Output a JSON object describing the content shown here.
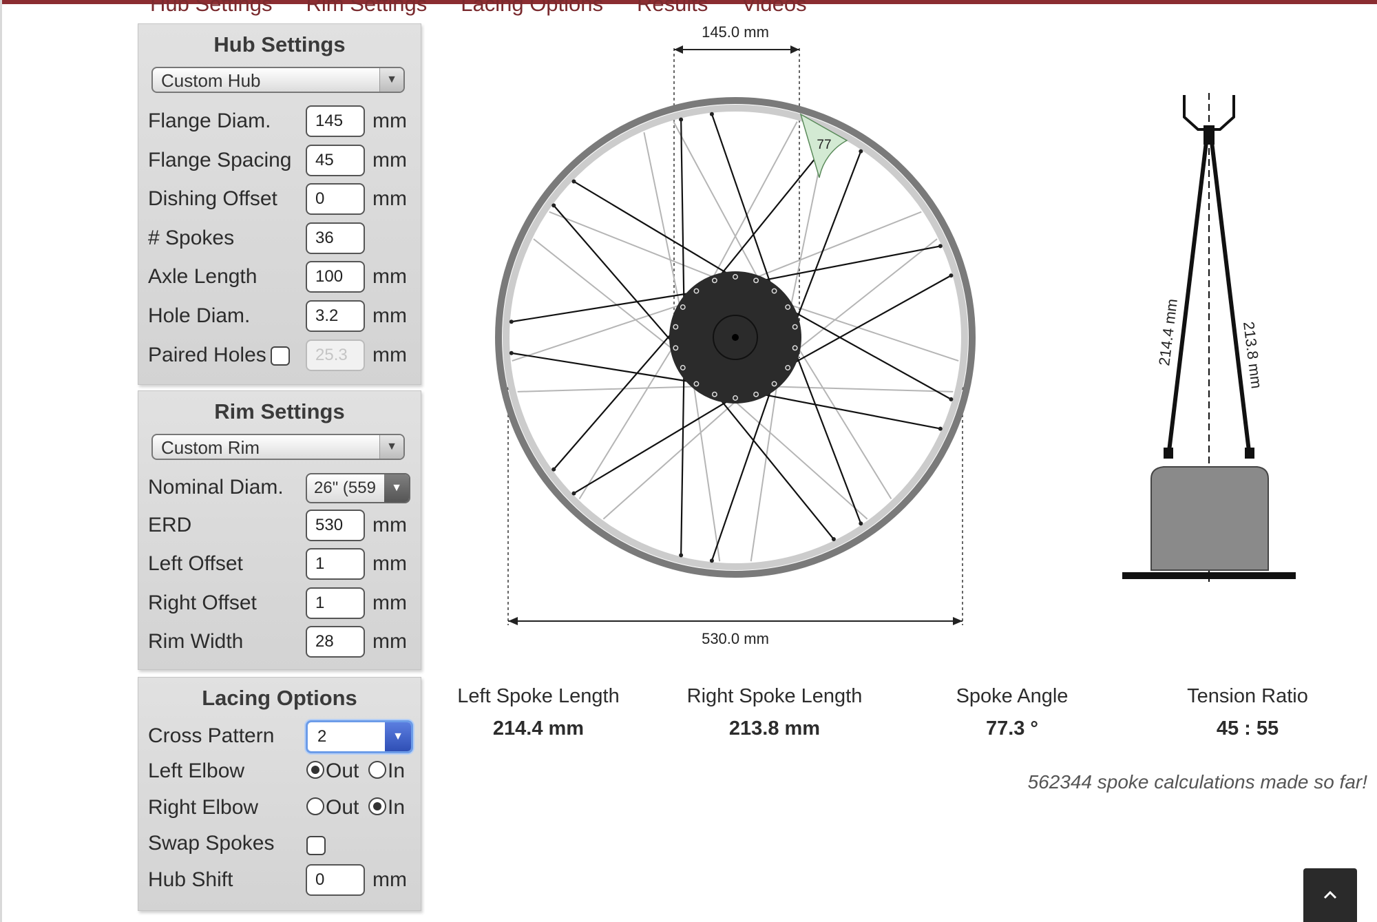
{
  "nav": {
    "items": [
      "Hub Settings",
      "Rim Settings",
      "Lacing Options",
      "Results",
      "Videos"
    ]
  },
  "hub": {
    "title": "Hub Settings",
    "preset": "Custom Hub",
    "flange_diam": {
      "label": "Flange Diam.",
      "value": "145",
      "unit": "mm"
    },
    "flange_spacing": {
      "label": "Flange Spacing",
      "value": "45",
      "unit": "mm"
    },
    "dishing_offset": {
      "label": "Dishing Offset",
      "value": "0",
      "unit": "mm"
    },
    "spokes": {
      "label": "# Spokes",
      "value": "36"
    },
    "axle_length": {
      "label": "Axle Length",
      "value": "100",
      "unit": "mm"
    },
    "hole_diam": {
      "label": "Hole Diam.",
      "value": "3.2",
      "unit": "mm"
    },
    "paired_holes": {
      "label": "Paired Holes",
      "value": "25.3",
      "unit": "mm",
      "checked": false
    }
  },
  "rim": {
    "title": "Rim Settings",
    "preset": "Custom Rim",
    "nominal_diam": {
      "label": "Nominal Diam.",
      "value": "26\" (559"
    },
    "erd": {
      "label": "ERD",
      "value": "530",
      "unit": "mm"
    },
    "left_offset": {
      "label": "Left Offset",
      "value": "1",
      "unit": "mm"
    },
    "right_offset": {
      "label": "Right Offset",
      "value": "1",
      "unit": "mm"
    },
    "rim_width": {
      "label": "Rim Width",
      "value": "28",
      "unit": "mm"
    }
  },
  "lacing": {
    "title": "Lacing Options",
    "cross_pattern": {
      "label": "Cross Pattern",
      "value": "2"
    },
    "left_elbow": {
      "label": "Left Elbow",
      "out": "Out",
      "in": "In",
      "selected": "Out"
    },
    "right_elbow": {
      "label": "Right Elbow",
      "out": "Out",
      "in": "In",
      "selected": "In"
    },
    "swap_spokes": {
      "label": "Swap Spokes",
      "checked": false
    },
    "hub_shift": {
      "label": "Hub Shift",
      "value": "0",
      "unit": "mm"
    }
  },
  "diagram": {
    "flange_dim": "145.0 mm",
    "rim_dim": "530.0 mm",
    "angle": "77",
    "left_spoke_dim": "214.4 mm",
    "right_spoke_dim": "213.8 mm",
    "spoke_count": 36,
    "colors": {
      "rim": "#7a7a7a",
      "rim_inner": "#c8c8c8",
      "hub": "#2b2b2b",
      "angle_fill": "#d3ead3",
      "profile": "#8a8a8a"
    }
  },
  "results": {
    "left": {
      "title": "Left Spoke Length",
      "value": "214.4 mm"
    },
    "right": {
      "title": "Right Spoke Length",
      "value": "213.8 mm"
    },
    "angle": {
      "title": "Spoke Angle",
      "value": "77.3 °"
    },
    "tension": {
      "title": "Tension Ratio",
      "value": "45 : 55"
    }
  },
  "counter": "562344 spoke calculations made so far!",
  "icons": {
    "scroll_top": "chevron-up-icon",
    "dropdown": "triangle-down-icon"
  }
}
